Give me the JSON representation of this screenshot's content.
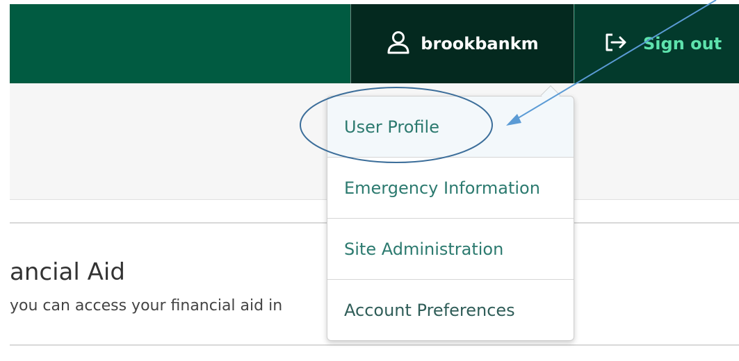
{
  "header": {
    "username": "brookbankm",
    "sign_out_label": "Sign out"
  },
  "user_menu": {
    "items": [
      {
        "label": "User Profile",
        "highlighted": true
      },
      {
        "label": "Emergency Information"
      },
      {
        "label": "Site Administration"
      },
      {
        "label": "Account Preferences"
      }
    ]
  },
  "content": {
    "card_title": "ancial Aid",
    "card_description": "you can access your financial aid in"
  },
  "colors": {
    "header_bg": "#015b41",
    "user_button_bg": "#04291f",
    "sign_out_text": "#5ee3ad",
    "menu_link": "#2c7a6f",
    "annotation": "#3c6e9a"
  },
  "icons": {
    "user": "user-icon",
    "sign_out": "sign-out-icon"
  }
}
